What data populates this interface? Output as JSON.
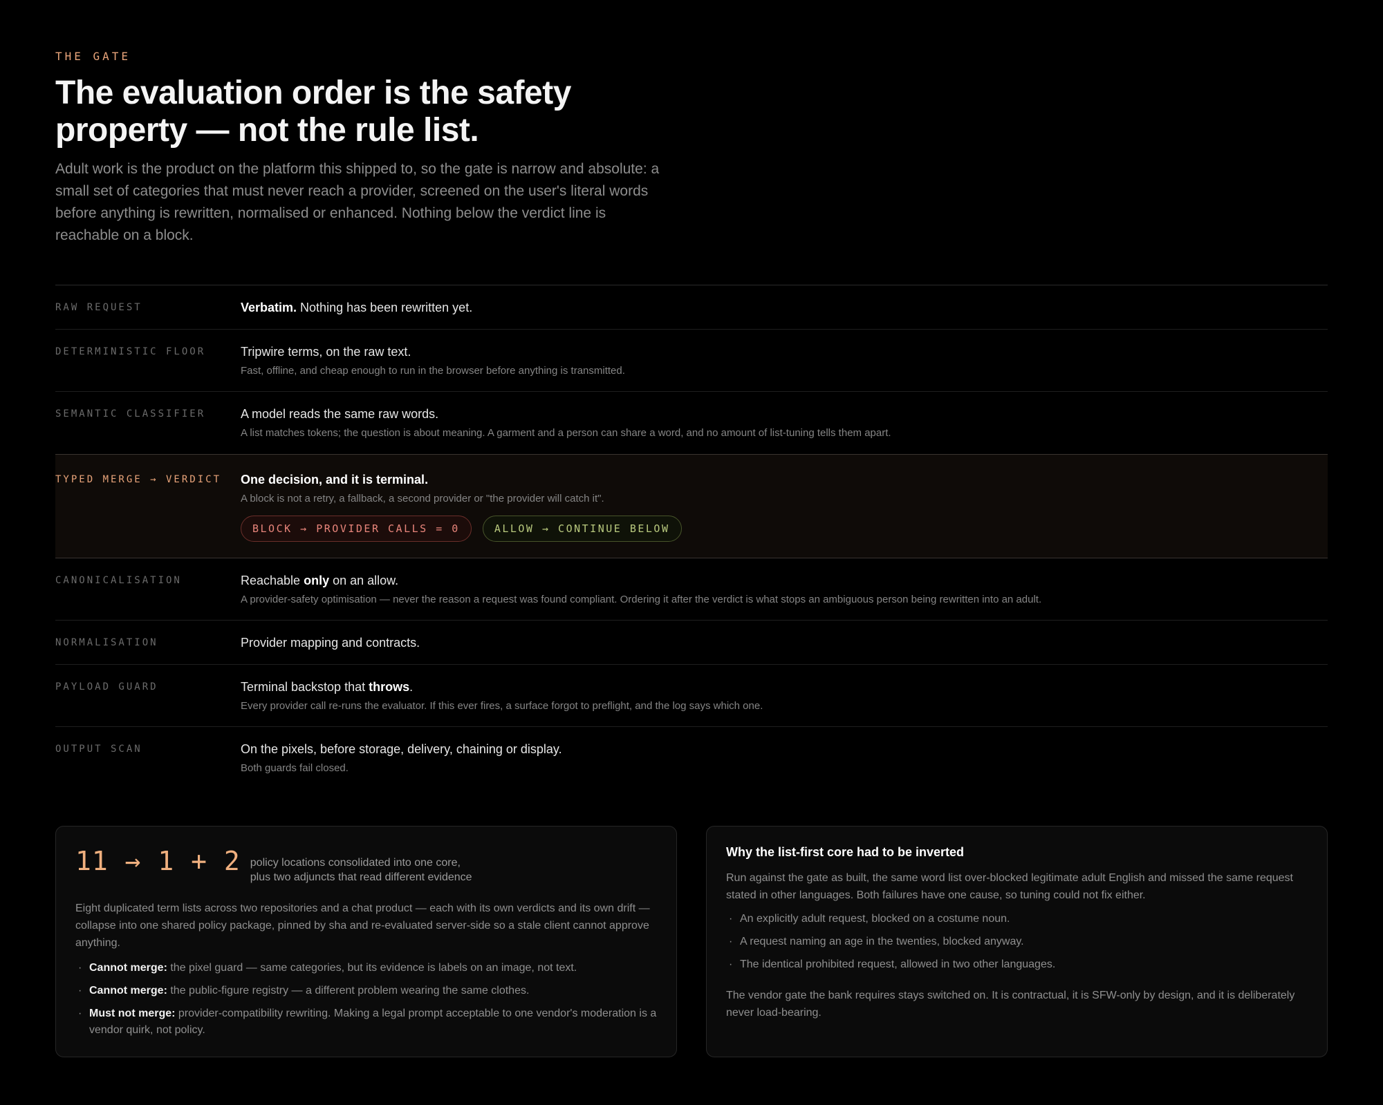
{
  "header": {
    "eyebrow": "THE GATE",
    "title_line1": "The evaluation order is the safety",
    "title_line2": "property — not the rule list.",
    "lede": "Adult work is the product on the platform this shipped to, so the gate is narrow and absolute: a small set of categories that must never reach a provider, screened on the user's literal words before anything is rewritten, normalised or enhanced. Nothing below the verdict line is reachable on a block."
  },
  "stages": {
    "raw": {
      "label": "RAW REQUEST",
      "head_bold": "Verbatim.",
      "head_rest": " Nothing has been rewritten yet."
    },
    "floor": {
      "label": "DETERMINISTIC FLOOR",
      "head": "Tripwire terms, on the raw text.",
      "sub": "Fast, offline, and cheap enough to run in the browser before anything is transmitted."
    },
    "semantic": {
      "label": "SEMANTIC CLASSIFIER",
      "head": "A model reads the same raw words.",
      "sub": "A list matches tokens; the question is about meaning. A garment and a person can share a word, and no amount of list-tuning tells them apart."
    },
    "verdict": {
      "label": "TYPED MERGE → VERDICT",
      "head": "One decision, and it is terminal.",
      "sub": "A block is not a retry, a fallback, a second provider or \"the provider will catch it\".",
      "block_pill": "BLOCK → PROVIDER CALLS = 0",
      "allow_pill": "ALLOW → CONTINUE BELOW"
    },
    "canon": {
      "label": "CANONICALISATION",
      "head_pre": "Reachable ",
      "head_bold": "only",
      "head_post": " on an allow.",
      "sub": "A provider-safety optimisation — never the reason a request was found compliant. Ordering it after the verdict is what stops an ambiguous person being rewritten into an adult."
    },
    "norm": {
      "label": "NORMALISATION",
      "head": "Provider mapping and contracts."
    },
    "payload": {
      "label": "PAYLOAD GUARD",
      "head_pre": "Terminal backstop that ",
      "head_bold": "throws",
      "head_post": ".",
      "sub": "Every provider call re-runs the evaluator. If this ever fires, a surface forgot to preflight, and the log says which one."
    },
    "output": {
      "label": "OUTPUT SCAN",
      "head": "On the pixels, before storage, delivery, chaining or display.",
      "sub": "Both guards fail closed."
    }
  },
  "left_card": {
    "stat": "11 → 1 + 2",
    "caption_line1": "policy locations consolidated into one core,",
    "caption_line2": "plus two adjuncts that read different evidence",
    "para": "Eight duplicated term lists across two repositories and a chat product — each with its own verdicts and its own drift — collapse into one shared policy package, pinned by sha and re-evaluated server-side so a stale client cannot approve anything.",
    "items": [
      {
        "bold": "Cannot merge:",
        "text": " the pixel guard — same categories, but its evidence is labels on an image, not text."
      },
      {
        "bold": "Cannot merge:",
        "text": " the public-figure registry — a different problem wearing the same clothes."
      },
      {
        "bold": "Must not merge:",
        "text": " provider-compatibility rewriting. Making a legal prompt acceptable to one vendor's moderation is a vendor quirk, not policy."
      }
    ]
  },
  "right_card": {
    "title": "Why the list-first core had to be inverted",
    "para1": "Run against the gate as built, the same word list over-blocked legitimate adult English and missed the same request stated in other languages. Both failures have one cause, so tuning could not fix either.",
    "items": [
      "An explicitly adult request, blocked on a costume noun.",
      "A request naming an age in the twenties, blocked anyway.",
      "The identical prohibited request, allowed in two other languages."
    ],
    "para2": "The vendor gate the bank requires stays switched on. It is contractual, it is SFW-only by design, and it is deliberately never load-bearing."
  }
}
